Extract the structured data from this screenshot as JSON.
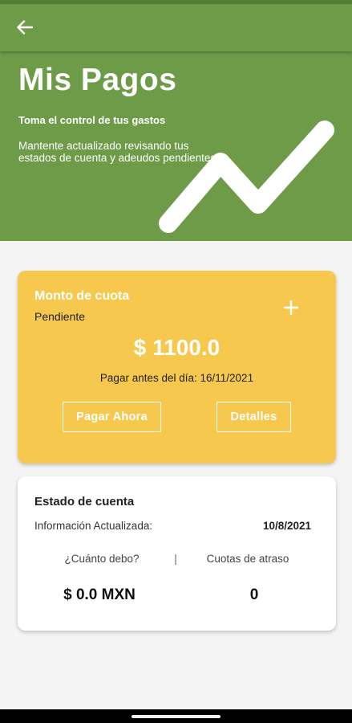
{
  "app_bar": {
    "back_icon": "arrow-left-icon"
  },
  "hero": {
    "title": "Mis Pagos",
    "subtitle": "Toma el control de tus gastos",
    "description": "Mantente actualizado revisando tus estados de cuenta y adeudos pendientes.",
    "graphic_icon": "trend-up-line-icon"
  },
  "due_card": {
    "title": "Monto de cuota",
    "status": "Pendiente",
    "add_icon": "plus-icon",
    "amount": "$ 1100.0",
    "due_date": "Pagar antes del día: 16/11/2021",
    "pay_now_label": "Pagar Ahora",
    "details_label": "Detalles"
  },
  "account_card": {
    "title": "Estado de cuenta",
    "updated_label": "Información Actualizada:",
    "updated_value": "10/8/2021",
    "owed_label": "¿Cuánto debo?",
    "separator": "|",
    "late_label": "Cuotas de atraso",
    "owed_value": "$ 0.0 MXN",
    "late_value": "0"
  },
  "colors": {
    "primary_green": "#6d9b48",
    "status_green": "#4f7f34",
    "accent_yellow": "#f6c84d",
    "background": "#f4f4f4"
  }
}
